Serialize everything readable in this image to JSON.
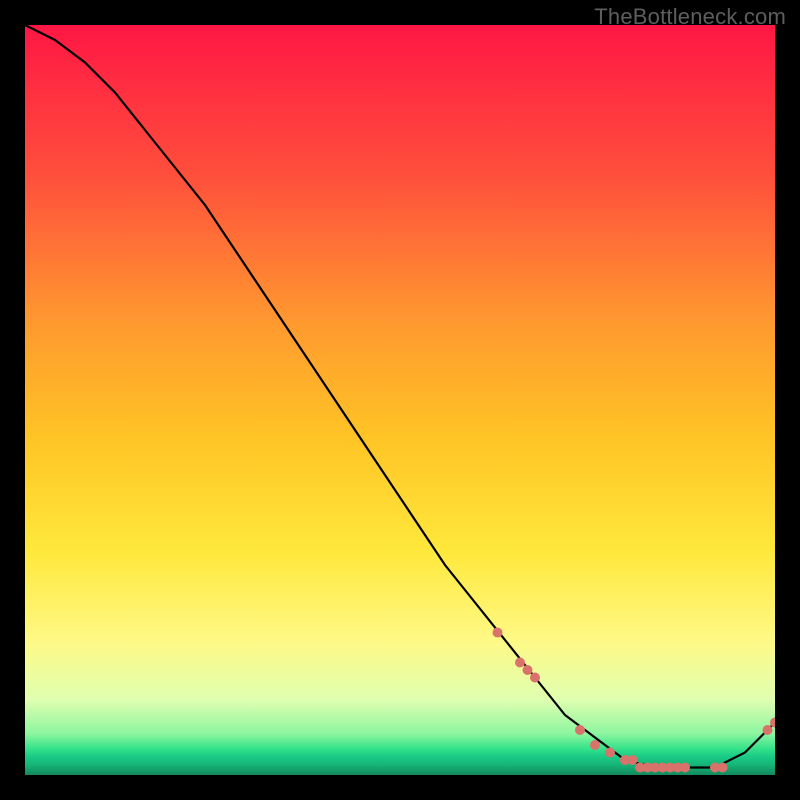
{
  "watermark": "TheBottleneck.com",
  "chart_data": {
    "type": "line",
    "title": "",
    "xlabel": "",
    "ylabel": "",
    "xlim": [
      0,
      100
    ],
    "ylim": [
      0,
      100
    ],
    "grid": false,
    "series": [
      {
        "name": "curve",
        "x": [
          0,
          4,
          8,
          12,
          16,
          20,
          24,
          28,
          32,
          36,
          40,
          44,
          48,
          52,
          56,
          60,
          64,
          68,
          72,
          76,
          80,
          84,
          88,
          92,
          96,
          100
        ],
        "y": [
          100,
          98,
          95,
          91,
          86,
          81,
          76,
          70,
          64,
          58,
          52,
          46,
          40,
          34,
          28,
          23,
          18,
          13,
          8,
          5,
          2,
          1,
          1,
          1,
          3,
          7
        ]
      }
    ],
    "scatter_points": {
      "name": "highlighted-points",
      "color": "#d9726b",
      "x": [
        63,
        66,
        67,
        68,
        74,
        76,
        78,
        80,
        81,
        82,
        83,
        84,
        85,
        86,
        87,
        88,
        92,
        93,
        99,
        100
      ],
      "y": [
        19,
        15,
        14,
        13,
        6,
        4,
        3,
        2,
        2,
        1,
        1,
        1,
        1,
        1,
        1,
        1,
        1,
        1,
        6,
        7
      ]
    },
    "background_gradient": {
      "stops": [
        {
          "offset": 0.0,
          "color": "#ff1744"
        },
        {
          "offset": 0.2,
          "color": "#ff4f3c"
        },
        {
          "offset": 0.4,
          "color": "#ff9a2f"
        },
        {
          "offset": 0.55,
          "color": "#ffc425"
        },
        {
          "offset": 0.7,
          "color": "#ffe83b"
        },
        {
          "offset": 0.82,
          "color": "#fff985"
        },
        {
          "offset": 0.9,
          "color": "#dfffb0"
        },
        {
          "offset": 0.945,
          "color": "#8cf5a0"
        },
        {
          "offset": 0.965,
          "color": "#34e28a"
        },
        {
          "offset": 0.975,
          "color": "#1acb86"
        },
        {
          "offset": 0.985,
          "color": "#16b879"
        },
        {
          "offset": 1.0,
          "color": "#128a5e"
        }
      ]
    }
  }
}
